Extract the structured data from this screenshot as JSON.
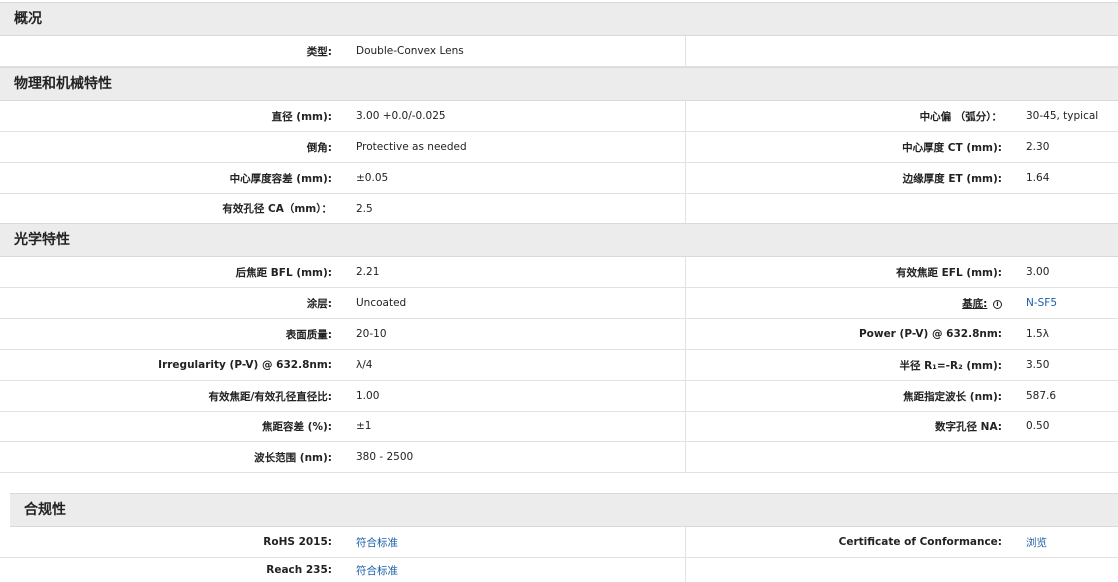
{
  "sections": {
    "overview": "概况",
    "mechanical": "物理和机械特性",
    "optical": "光学特性",
    "compliance": "合规性"
  },
  "overview_rows": [
    {
      "label": "类型:",
      "value": "Double-Convex Lens"
    }
  ],
  "mechanical_rows": [
    {
      "label": "直径 (mm):",
      "value": "3.00 +0.0/-0.025",
      "r_label": "中心偏 （弧分）：",
      "r_value": "30-45, typical"
    },
    {
      "label": "倒角:",
      "value": "Protective as needed",
      "r_label": "中心厚度 CT (mm):",
      "r_value": "2.30"
    },
    {
      "label": "中心厚度容差 (mm):",
      "value": "±0.05",
      "r_label": "边缘厚度 ET (mm):",
      "r_value": "1.64"
    },
    {
      "label": "有效孔径 CA（mm）：",
      "value": "2.5"
    }
  ],
  "optical_rows": [
    {
      "label": "后焦距 BFL (mm):",
      "value": "2.21",
      "r_label": "有效焦距 EFL (mm):",
      "r_value": "3.00"
    },
    {
      "label": "涂层:",
      "value": "Uncoated",
      "r_label": "基底:",
      "r_value": "N-SF5"
    },
    {
      "label": "表面质量:",
      "value": "20-10",
      "r_label": "Power (P-V) @ 632.8nm:",
      "r_value": "1.5λ"
    },
    {
      "label": "Irregularity (P-V) @ 632.8nm:",
      "value": "λ/4",
      "r_label": "半径 R₁=-R₂ (mm):",
      "r_value": "3.50"
    },
    {
      "label": "有效焦距/有效孔径直径比:",
      "value": "1.00",
      "r_label": "焦距指定波长 (nm):",
      "r_value": "587.6"
    },
    {
      "label": "焦距容差 (%):",
      "value": "±1",
      "r_label": "数字孔径 NA:",
      "r_value": "0.50"
    },
    {
      "label": "波长范围 (nm):",
      "value": "380 - 2500"
    }
  ],
  "compliance_rows": [
    {
      "label": "RoHS 2015:",
      "value": "符合标准",
      "r_label": "Certificate of Conformance:",
      "r_value": "浏览"
    },
    {
      "label": "Reach 235:",
      "value": "符合标准"
    }
  ],
  "colors": {
    "link": "#1a5fa6",
    "header_bg": "#ececec"
  }
}
